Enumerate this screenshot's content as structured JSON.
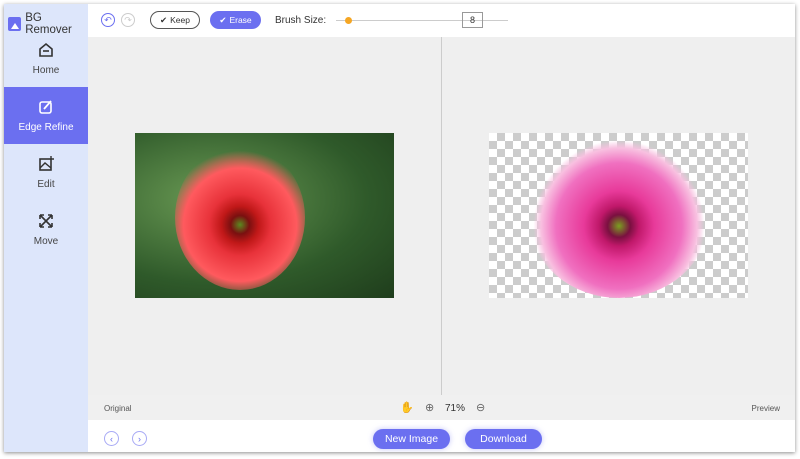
{
  "app": {
    "title": "BG Remover"
  },
  "sidebar": {
    "items": [
      {
        "label": "Home"
      },
      {
        "label": "Edge Refine"
      },
      {
        "label": "Edit"
      },
      {
        "label": "Move"
      }
    ]
  },
  "toolbar": {
    "keep_label": "Keep",
    "erase_label": "Erase",
    "brush_label": "Brush Size:",
    "brush_value": "8",
    "brush_fraction": 0.05
  },
  "status": {
    "left_label": "Original",
    "right_label": "Preview",
    "zoom": "71%"
  },
  "footer": {
    "new_image": "New Image",
    "download": "Download"
  },
  "colors": {
    "accent": "#6b6ff0",
    "slider": "#f5a623",
    "sidebar": "#dde6fb"
  }
}
